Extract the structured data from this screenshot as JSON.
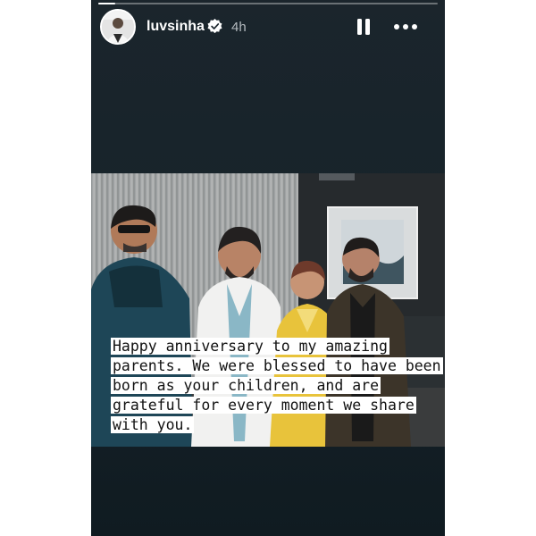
{
  "story": {
    "username": "luvsinha",
    "verified": true,
    "time_ago": "4h",
    "progress": 0.05,
    "caption": "Happy anniversary to my amazing parents. We were blessed to have been born as your children, and are grateful for every moment we share with you."
  },
  "icons": {
    "verified": "verified-badge-icon",
    "pause": "pause-icon",
    "more": "more-options-icon"
  },
  "colors": {
    "background": "#17232a",
    "text": "#ffffff",
    "muted": "#b5bcc0"
  }
}
